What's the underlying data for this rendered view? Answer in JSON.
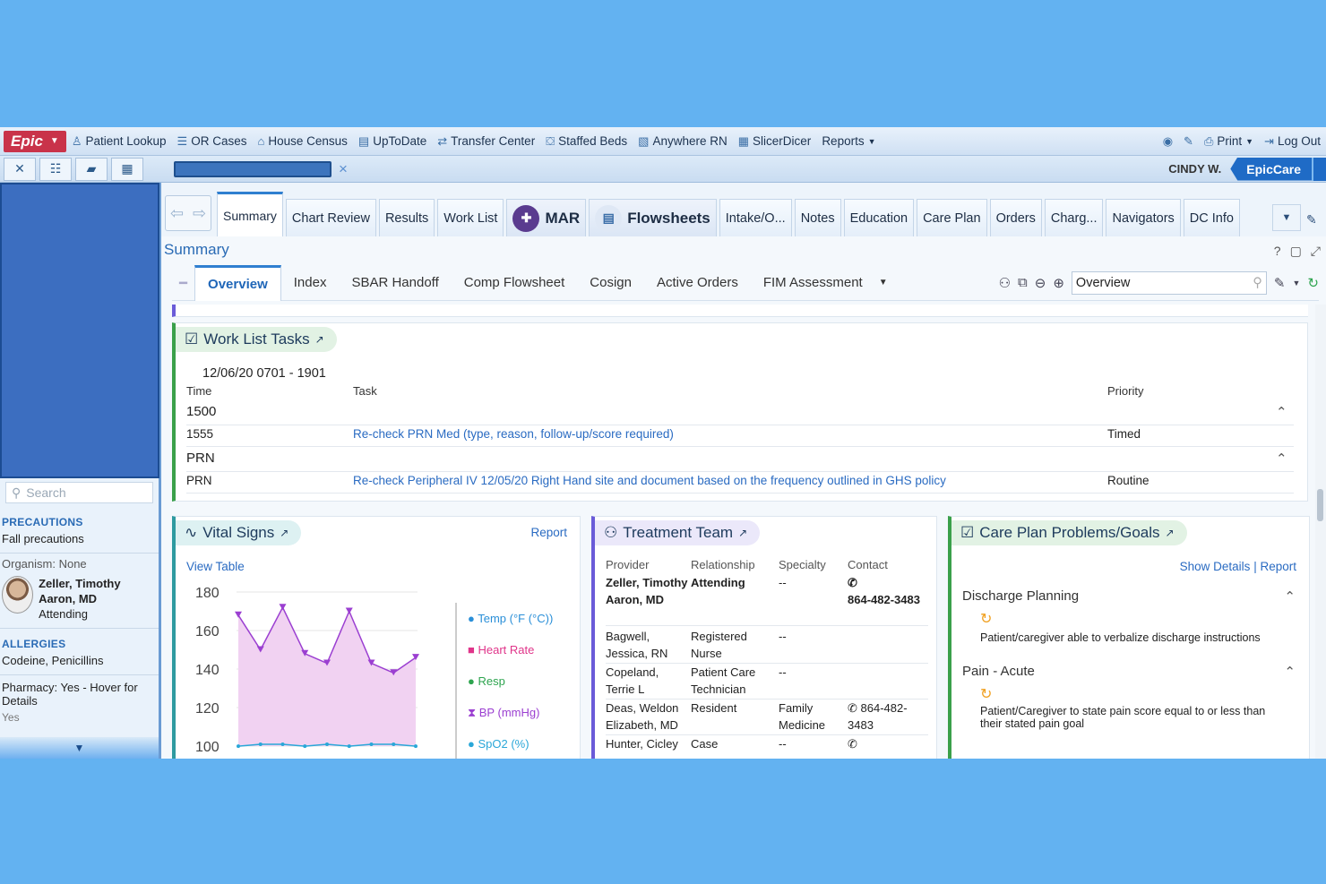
{
  "menubar": {
    "epic_label": "Epic",
    "items": [
      {
        "icon": "patient-lookup-icon",
        "label": "Patient Lookup"
      },
      {
        "icon": "or-cases-icon",
        "label": "OR Cases"
      },
      {
        "icon": "house-icon",
        "label": "House Census"
      },
      {
        "icon": "uptodate-icon",
        "label": "UpToDate"
      },
      {
        "icon": "transfer-icon",
        "label": "Transfer Center"
      },
      {
        "icon": "beds-icon",
        "label": "Staffed Beds"
      },
      {
        "icon": "anywhere-icon",
        "label": "Anywhere RN"
      },
      {
        "icon": "slicer-icon",
        "label": "SlicerDicer"
      },
      {
        "icon": "",
        "label": "Reports"
      }
    ],
    "print_label": "Print",
    "logout_label": "Log Out"
  },
  "toolbar": {
    "user": "CINDY W.",
    "brand": "EpicCare"
  },
  "sidebar": {
    "search_placeholder": "Search",
    "precautions_header": "PRECAUTIONS",
    "precautions_value": "Fall precautions",
    "organism": "Organism: None",
    "provider_name": "Zeller, Timothy Aaron, MD",
    "provider_role": "Attending",
    "allergies_header": "ALLERGIES",
    "allergies_value": "Codeine, Penicillins",
    "pharmacy": "Pharmacy: Yes - Hover for Details",
    "partial": "Yes"
  },
  "activity_tabs": [
    "Summary",
    "Chart Review",
    "Results",
    "Work List",
    "MAR",
    "Flowsheets",
    "Intake/O...",
    "Notes",
    "Education",
    "Care Plan",
    "Orders",
    "Charg...",
    "Navigators",
    "DC Info"
  ],
  "summary_title": "Summary",
  "sub_tabs": [
    "Overview",
    "Index",
    "SBAR Handoff",
    "Comp Flowsheet",
    "Cosign",
    "Active Orders",
    "FIM Assessment"
  ],
  "overview_search": "Overview",
  "worklist": {
    "title": "Work List Tasks",
    "date_range": "12/06/20 0701 - 1901",
    "col_time": "Time",
    "col_task": "Task",
    "col_priority": "Priority",
    "group1": "1500",
    "row1_time": "1555",
    "row1_task": "Re-check PRN Med (type, reason, follow-up/score required)",
    "row1_priority": "Timed",
    "group2": "PRN",
    "row2_time": "PRN",
    "row2_task": "Re-check Peripheral IV 12/05/20 Right Hand site and document based on the frequency outlined in GHS policy",
    "row2_priority": "Routine"
  },
  "vitals": {
    "title": "Vital Signs",
    "report": "Report",
    "view_table": "View Table",
    "legend": [
      {
        "name": "Temp (°F (°C))",
        "color": "#2a8fd8"
      },
      {
        "name": "Heart Rate",
        "color": "#e0358a"
      },
      {
        "name": "Resp",
        "color": "#2ea44f"
      },
      {
        "name": "BP (mmHg)",
        "color": "#9b3fd1"
      },
      {
        "name": "SpO2 (%)",
        "color": "#2aa7d8"
      }
    ]
  },
  "chart_data": {
    "type": "line",
    "yticks": [
      180,
      160,
      140,
      120,
      100
    ],
    "ylim": [
      100,
      180
    ],
    "series": [
      {
        "name": "BP (mmHg)",
        "values": [
          168,
          150,
          172,
          148,
          143,
          170,
          143,
          138,
          146
        ]
      },
      {
        "name": "SpO2 (%)",
        "values": [
          99,
          100,
          100,
          99,
          100,
          99,
          100,
          100,
          99
        ]
      }
    ]
  },
  "treatment_team": {
    "title": "Treatment Team",
    "headers": [
      "Provider",
      "Relationship",
      "Specialty",
      "Contact"
    ],
    "rows": [
      [
        "Zeller, Timothy Aaron, MD",
        "Attending",
        "--",
        "864-482-3483"
      ],
      [
        "Bagwell, Jessica, RN",
        "Registered Nurse",
        "--",
        ""
      ],
      [
        "Copeland, Terrie L",
        "Patient Care Technician",
        "--",
        ""
      ],
      [
        "Deas, Weldon Elizabeth, MD",
        "Resident",
        "Family Medicine",
        "864-482-3483"
      ],
      [
        "Hunter, Cicley",
        "Case",
        "--",
        ""
      ]
    ]
  },
  "care_plan": {
    "title": "Care Plan Problems/Goals",
    "show_details": "Show Details",
    "separator": "|",
    "report": "Report",
    "problem1": "Discharge Planning",
    "goal1": "Patient/caregiver able to verbalize discharge instructions",
    "problem2": "Pain - Acute",
    "goal2": "Patient/Caregiver to state pain score equal to or less than their stated pain goal"
  }
}
